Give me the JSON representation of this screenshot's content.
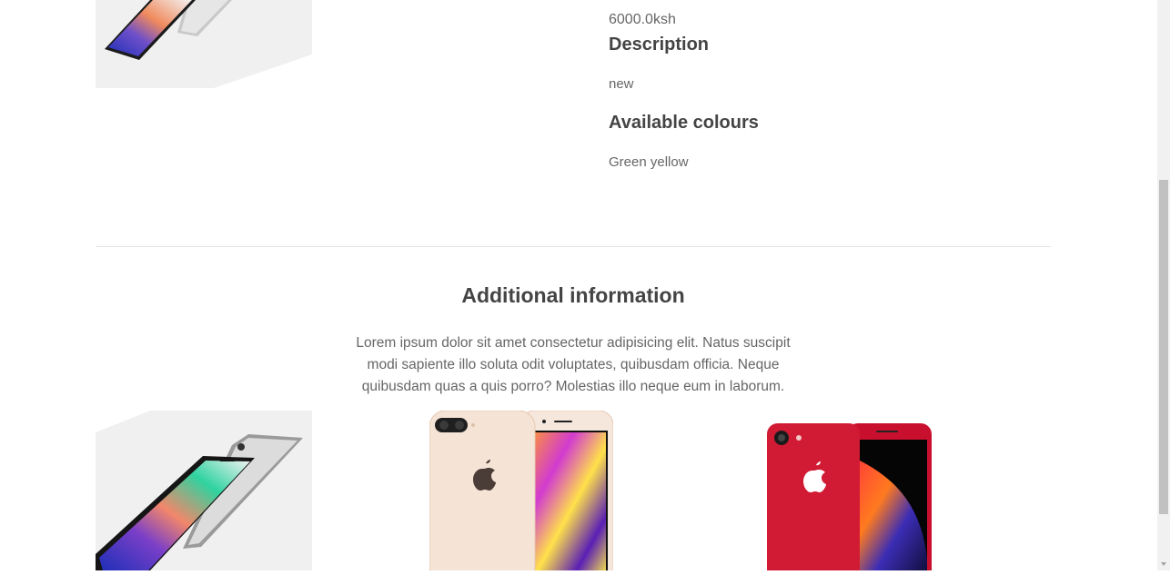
{
  "product": {
    "price": "6000.0ksh",
    "description_heading": "Description",
    "description": "new",
    "colours_heading": "Available colours",
    "colours": "Green yellow"
  },
  "additional": {
    "heading": "Additional information",
    "text": "Lorem ipsum dolor sit amet consectetur adipisicing elit. Natus suscipit modi sapiente illo soluta odit voluptates, quibusdam officia. Neque quibusdam quas a quis porro? Molestias illo neque eum in laborum."
  },
  "related": [
    {
      "name": "iphone-x-image"
    },
    {
      "name": "iphone-8-plus-gold-image"
    },
    {
      "name": "iphone-8-red-image"
    }
  ],
  "colors": {
    "text": "#666666",
    "heading": "#444444",
    "divider": "#e3e3e3",
    "product_red": "#c8102e",
    "product_gold": "#f4e2d3"
  }
}
